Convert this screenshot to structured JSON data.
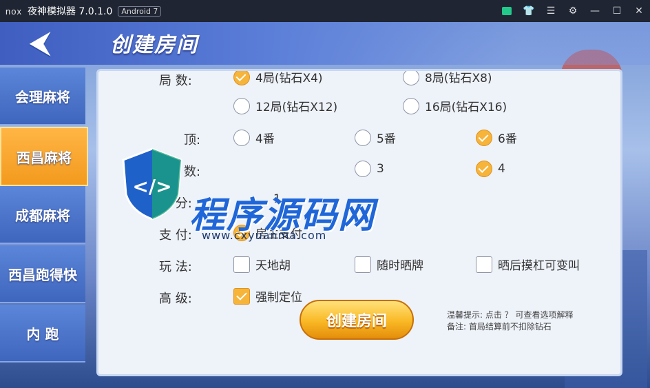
{
  "window": {
    "logo": "nox",
    "title": "夜神模拟器 7.0.1.0",
    "android_badge": "Android 7",
    "icons": [
      "store-icon",
      "skin-icon",
      "menu-icon",
      "settings-icon",
      "minimize-icon",
      "maximize-icon",
      "close-icon"
    ],
    "icon_glyphs": [
      "",
      "👕",
      "☰",
      "⚙",
      "—",
      "☐",
      "✕"
    ]
  },
  "header": {
    "back_glyph": "⮜",
    "title": "创建房间"
  },
  "sidebar": {
    "items": [
      {
        "label": "会理麻将",
        "active": false
      },
      {
        "label": "西昌麻将",
        "active": true
      },
      {
        "label": "成都麻将",
        "active": false
      },
      {
        "label": "西昌跑得快",
        "active": false
      },
      {
        "label": "内  跑",
        "active": false
      }
    ]
  },
  "form": {
    "rows": {
      "rounds_label": "局   数:",
      "cap_label": "  顶:",
      "people_label": "  数:",
      "base_label": "底   分:",
      "pay_label": "支   付:",
      "rules_label": "玩   法:",
      "advanced_label": "高   级:"
    },
    "rounds": [
      {
        "label": "4局(钻石X4)",
        "checked": true
      },
      {
        "label": "8局(钻石X8)",
        "checked": false
      },
      {
        "label": "12局(钻石X12)",
        "checked": false
      },
      {
        "label": "16局(钻石X16)",
        "checked": false
      }
    ],
    "cap": [
      {
        "label": "4番",
        "checked": false
      },
      {
        "label": "5番",
        "checked": false
      },
      {
        "label": "6番",
        "checked": true
      }
    ],
    "people": [
      {
        "label": "3",
        "checked": false
      },
      {
        "label": "4",
        "checked": true
      }
    ],
    "base_value": "1",
    "pay": [
      {
        "label": "房主支付",
        "checked": true
      }
    ],
    "rules": [
      {
        "label": "天地胡",
        "checked": false
      },
      {
        "label": "随时晒牌",
        "checked": false
      },
      {
        "label": "晒后摸杠可变叫",
        "checked": false
      }
    ],
    "advanced": [
      {
        "label": "强制定位",
        "checked": true
      }
    ]
  },
  "create_button": "创建房间",
  "tips": {
    "line1": "温馨提示: 点击 ？ 可查看选项解释",
    "line2": "备注: 首局结算前不扣除钻石"
  },
  "watermark": {
    "text": "程序源码网",
    "url": "www.cxyuanma.com"
  },
  "colors": {
    "accent": "#f7b43a",
    "sidebar_active": "#f39a1e",
    "sidebar_inactive": "#4a74cc",
    "titlebar": "#1f2532"
  }
}
